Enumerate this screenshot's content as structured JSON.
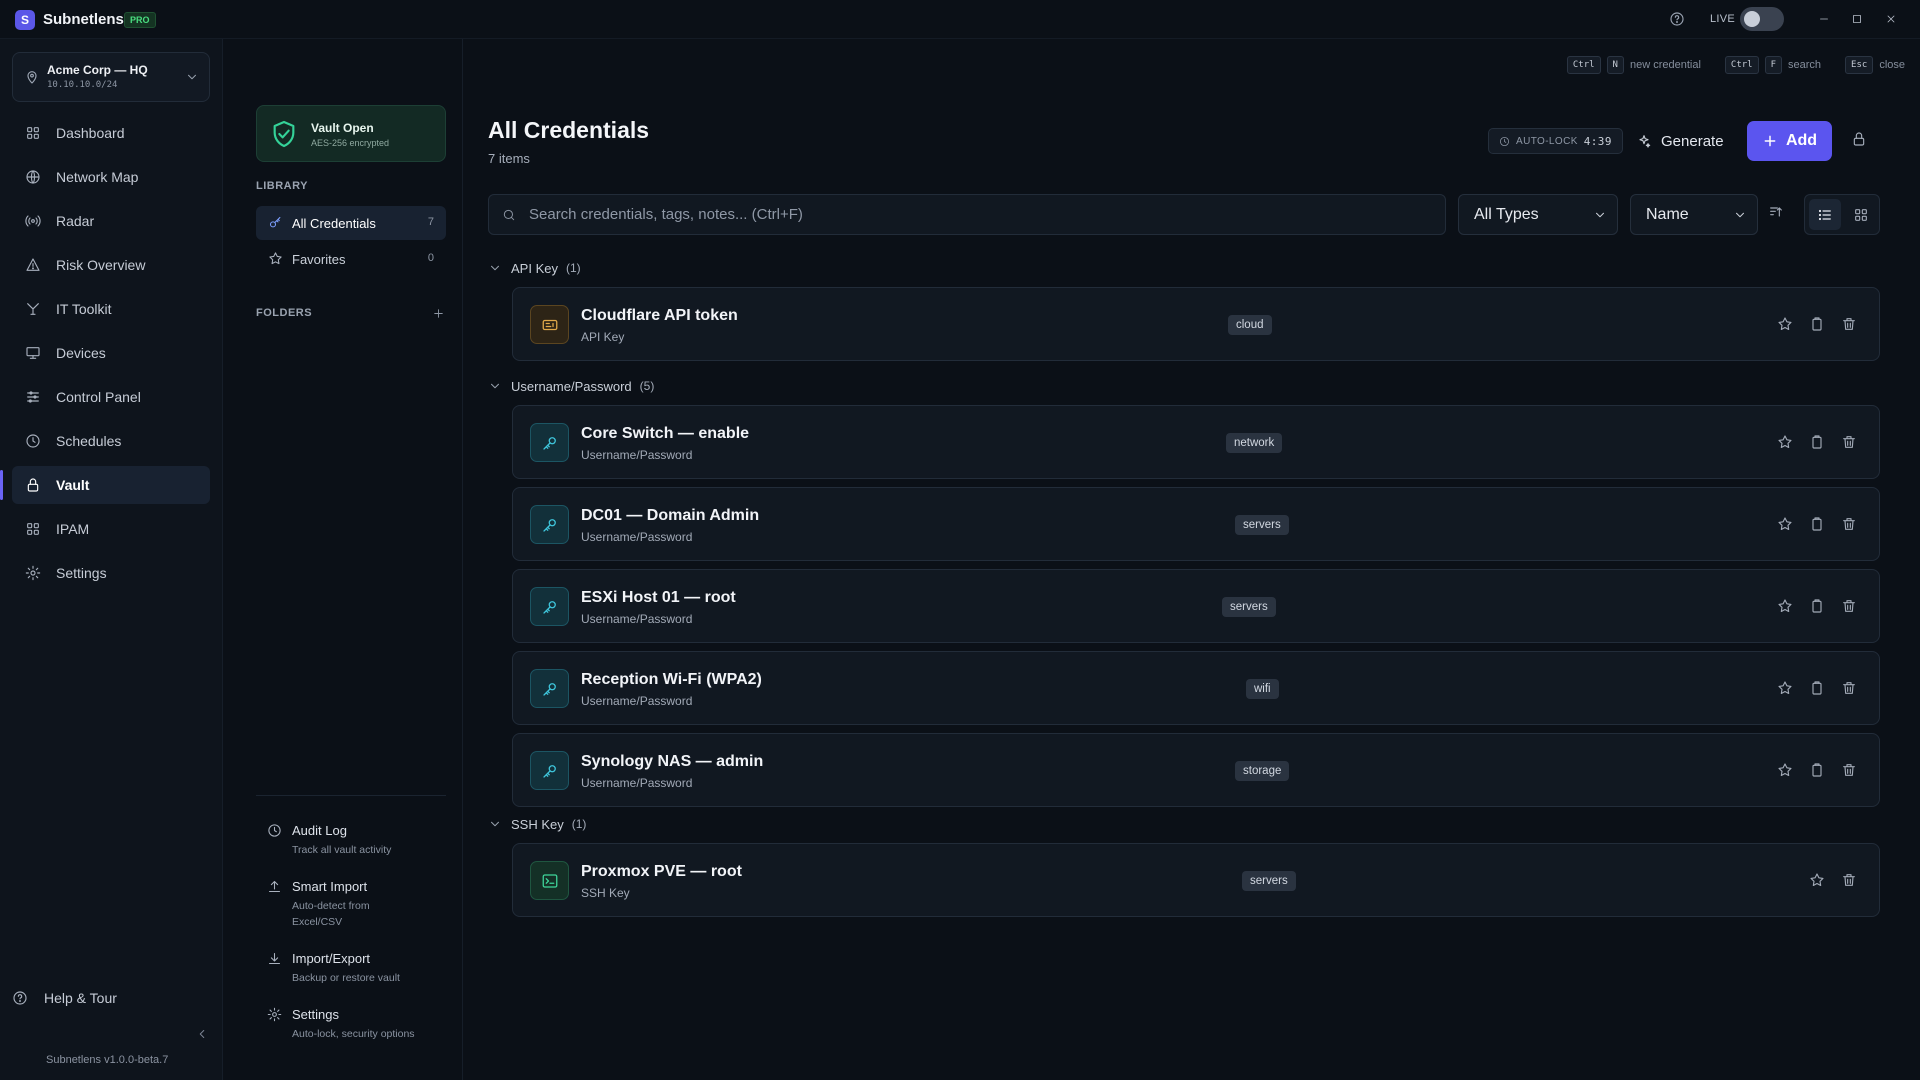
{
  "app": {
    "name": "Subnetlens",
    "logo_letter": "S",
    "badge": "PRO",
    "live_label": "LIVE",
    "version": "Subnetlens v1.0.0-beta.7"
  },
  "workspace": {
    "name": "Acme Corp — HQ",
    "subnet": "10.10.10.0/24"
  },
  "nav": {
    "items": [
      {
        "label": "Dashboard",
        "icon": "grid-icon"
      },
      {
        "label": "Network Map",
        "icon": "globe-icon"
      },
      {
        "label": "Radar",
        "icon": "radar-icon"
      },
      {
        "label": "Risk Overview",
        "icon": "warning-icon"
      },
      {
        "label": "IT Toolkit",
        "icon": "toolkit-icon"
      },
      {
        "label": "Devices",
        "icon": "monitor-icon"
      },
      {
        "label": "Control Panel",
        "icon": "sliders-icon"
      },
      {
        "label": "Schedules",
        "icon": "clock-icon"
      },
      {
        "label": "Vault",
        "icon": "lock-icon",
        "active": true
      },
      {
        "label": "IPAM",
        "icon": "grid-icon"
      },
      {
        "label": "Settings",
        "icon": "gear-icon"
      }
    ],
    "help_label": "Help & Tour"
  },
  "shortcuts": {
    "new": {
      "keys": [
        "Ctrl",
        "N"
      ],
      "label": "new credential"
    },
    "search": {
      "keys": [
        "Ctrl",
        "F"
      ],
      "label": "search"
    },
    "close": {
      "keys": [
        "Esc"
      ],
      "label": "close"
    }
  },
  "vault": {
    "status_title": "Vault Open",
    "status_sub": "AES-256 encrypted",
    "library_label": "LIBRARY",
    "library": [
      {
        "label": "All Credentials",
        "count": "7",
        "icon": "key-icon",
        "active": true
      },
      {
        "label": "Favorites",
        "count": "0",
        "icon": "star-icon"
      }
    ],
    "folders_label": "FOLDERS",
    "tools": [
      {
        "title": "Audit Log",
        "desc": "Track all vault activity",
        "icon": "clock-icon"
      },
      {
        "title": "Smart Import",
        "desc": "Auto-detect from Excel/CSV",
        "icon": "upload-icon"
      },
      {
        "title": "Import/Export",
        "desc": "Backup or restore vault",
        "icon": "download-icon"
      },
      {
        "title": "Settings",
        "desc": "Auto-lock, security options",
        "icon": "gear-icon"
      }
    ]
  },
  "main": {
    "title": "All Credentials",
    "subtitle": "7 items",
    "autolock_label": "AUTO-LOCK",
    "autolock_time": "4:39",
    "generate_label": "Generate",
    "add_label": "Add",
    "search_placeholder": "Search credentials, tags, notes... (Ctrl+F)",
    "type_filter": "All Types",
    "sort_by": "Name",
    "view_mode": "list"
  },
  "groups": [
    {
      "title": "API Key",
      "count": "(1)",
      "items": [
        {
          "name": "Cloudflare API token",
          "type": "API Key",
          "tag": "cloud",
          "kind": "key"
        }
      ]
    },
    {
      "title": "Username/Password",
      "count": "(5)",
      "items": [
        {
          "name": "Core Switch — enable",
          "type": "Username/Password",
          "tag": "network",
          "kind": "pw"
        },
        {
          "name": "DC01 — Domain Admin",
          "type": "Username/Password",
          "tag": "servers",
          "kind": "pw"
        },
        {
          "name": "ESXi Host 01 — root",
          "type": "Username/Password",
          "tag": "servers",
          "kind": "pw"
        },
        {
          "name": "Reception Wi-Fi (WPA2)",
          "type": "Username/Password",
          "tag": "wifi",
          "kind": "pw"
        },
        {
          "name": "Synology NAS — admin",
          "type": "Username/Password",
          "tag": "storage",
          "kind": "pw"
        }
      ]
    },
    {
      "title": "SSH Key",
      "count": "(1)",
      "items": [
        {
          "name": "Proxmox PVE — root",
          "type": "SSH Key",
          "tag": "servers",
          "kind": "ssh"
        }
      ]
    }
  ],
  "colors": {
    "accent": "#5b55ef",
    "vault_green": "#34d399",
    "background": "#0b1017"
  }
}
